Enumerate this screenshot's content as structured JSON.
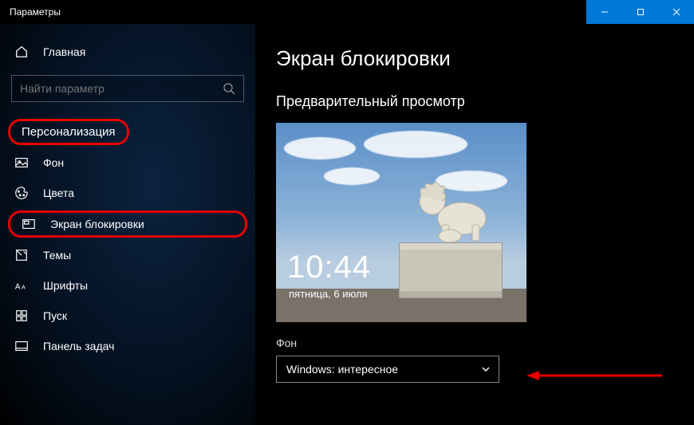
{
  "window_title": "Параметры",
  "home_label": "Главная",
  "search_placeholder": "Найти параметр",
  "category_label": "Персонализация",
  "nav": {
    "background": "Фон",
    "colors": "Цвета",
    "lockscreen": "Экран блокировки",
    "themes": "Темы",
    "fonts": "Шрифты",
    "start": "Пуск",
    "taskbar": "Панель задач"
  },
  "page_title": "Экран блокировки",
  "preview_label": "Предварительный просмотр",
  "preview": {
    "time": "10:44",
    "date": "пятница, 6 июля"
  },
  "background_field_label": "Фон",
  "dropdown_value": "Windows: интересное"
}
